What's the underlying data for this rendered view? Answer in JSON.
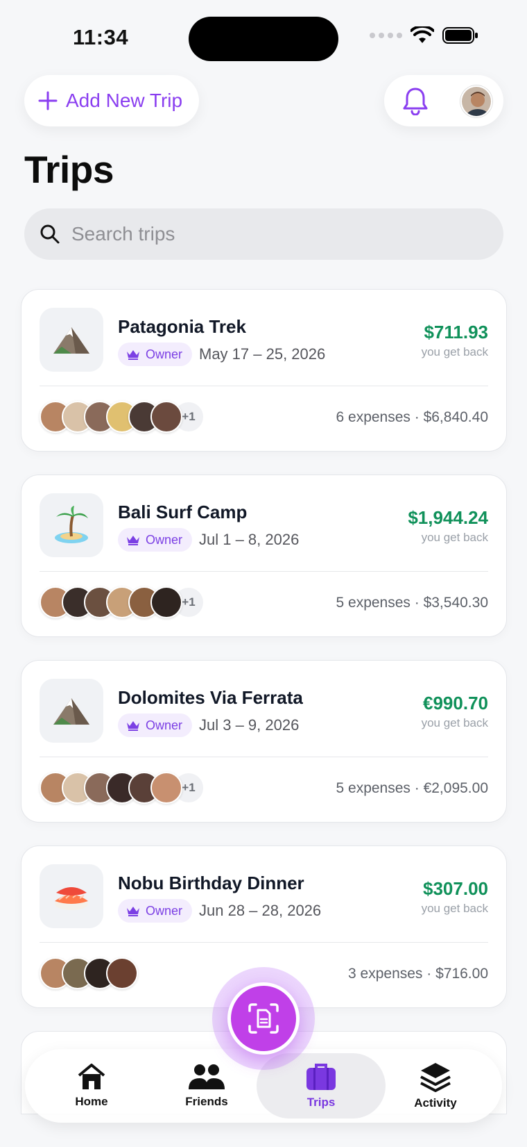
{
  "status_bar": {
    "time": "11:34"
  },
  "header": {
    "add_trip_label": "Add New Trip",
    "title": "Trips"
  },
  "search": {
    "placeholder": "Search trips",
    "value": ""
  },
  "trips": [
    {
      "name": "Patagonia Trek",
      "icon": "mountain-icon",
      "role": "Owner",
      "dates": "May 17 – 25, 2026",
      "amount": "$711.93",
      "amount_sub": "you get back",
      "members_more": "+1",
      "summary": "6 expenses · $6,840.40",
      "member_colors": [
        "#b88563",
        "#d9c2a8",
        "#8a6a5a",
        "#e0c070",
        "#4a3a35",
        "#6b4a3e"
      ]
    },
    {
      "name": "Bali Surf Camp",
      "icon": "palm-island-icon",
      "role": "Owner",
      "dates": "Jul 1 – 8, 2026",
      "amount": "$1,944.24",
      "amount_sub": "you get back",
      "members_more": "+1",
      "summary": "5 expenses · $3,540.30",
      "member_colors": [
        "#b88563",
        "#3a2e2a",
        "#6b5040",
        "#c8a078",
        "#8a6040",
        "#2e2420"
      ]
    },
    {
      "name": "Dolomites Via Ferrata",
      "icon": "mountain-icon",
      "role": "Owner",
      "dates": "Jul 3 – 9, 2026",
      "amount": "€990.70",
      "amount_sub": "you get back",
      "members_more": "+1",
      "summary": "5 expenses · €2,095.00",
      "member_colors": [
        "#b88563",
        "#d9c2a8",
        "#8a6a5a",
        "#3a2a28",
        "#5a4038",
        "#c89070"
      ]
    },
    {
      "name": "Nobu Birthday Dinner",
      "icon": "sushi-icon",
      "role": "Owner",
      "dates": "Jun 28 – 28, 2026",
      "amount": "$307.00",
      "amount_sub": "you get back",
      "members_more": "",
      "summary": "3 expenses · $716.00",
      "member_colors": [
        "#b88563",
        "#7a6a50",
        "#2e2420",
        "#6b4030"
      ]
    }
  ],
  "tabs": [
    {
      "label": "Home",
      "icon": "home-icon",
      "active": false
    },
    {
      "label": "Friends",
      "icon": "friends-icon",
      "active": false
    },
    {
      "label": "Trips",
      "icon": "suitcase-icon",
      "active": true
    },
    {
      "label": "Activity",
      "icon": "layers-icon",
      "active": false
    }
  ],
  "colors": {
    "accent": "#8a3ef0",
    "positive": "#10915a",
    "fab": "#c040e8"
  }
}
